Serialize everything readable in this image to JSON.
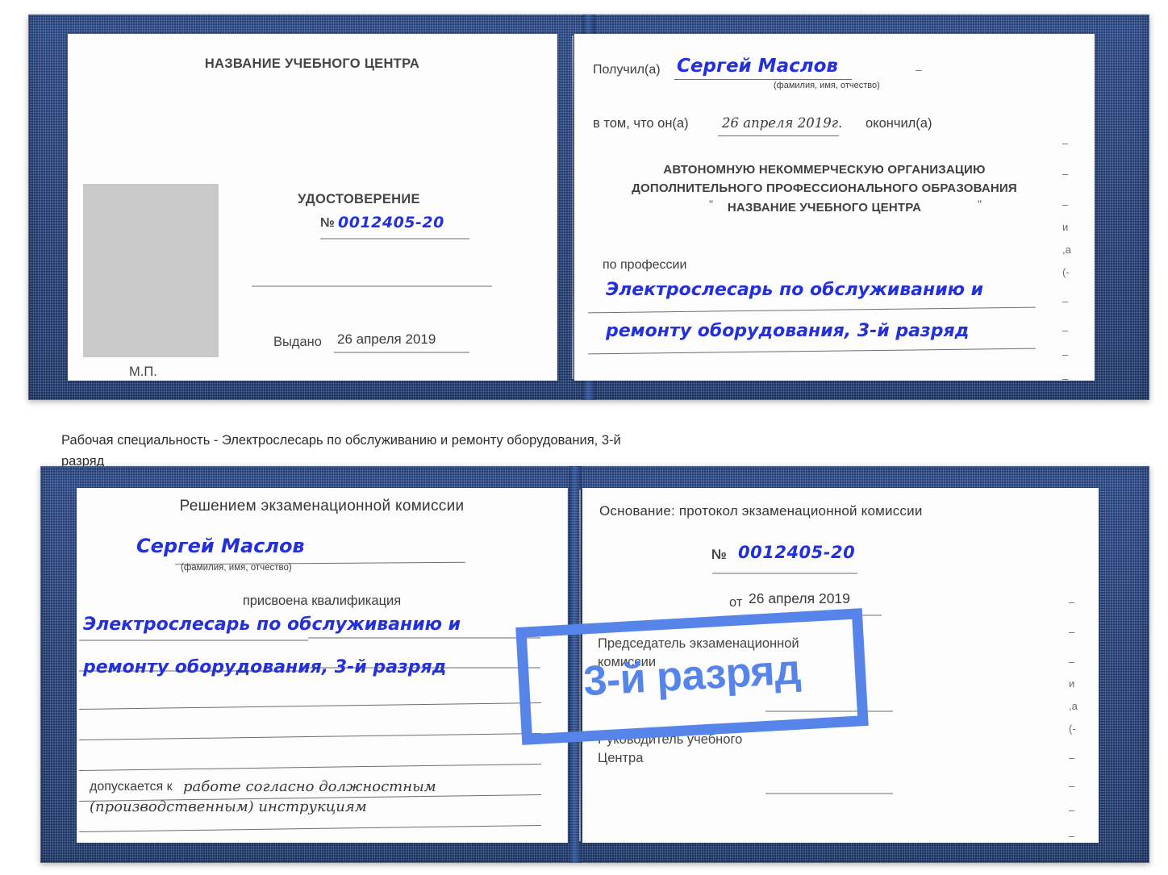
{
  "document": {
    "type": "certificate-scan",
    "colors": {
      "cover_blue": "#24417f",
      "handwriting_blue": "#2431d8",
      "watermark_blue": "#5684e8",
      "page_white": "#fdfdfd",
      "photo_placeholder_gray": "#c9c9c9",
      "rule_gray": "#9a9a9a"
    }
  },
  "caption": {
    "line1": "Рабочая специальность - Электрослесарь по обслуживанию и ремонту оборудования, 3-й",
    "line2": "разряд"
  },
  "watermark": {
    "text": "3-й разряд"
  },
  "certificate_top": {
    "left_page": {
      "org_title": "НАЗВАНИЕ УЧЕБНОГО ЦЕНТРА",
      "doc_title": "УДОСТОВЕРЕНИЕ",
      "number_label": "№",
      "number_value": "0012405-20",
      "issued_label": "Выдано",
      "issued_value": "26 апреля 2019",
      "seal_label": "М.П.",
      "photo_placeholder": "photo-placeholder"
    },
    "right_page": {
      "received_label": "Получил(а)",
      "received_value": "Сергей Маслов",
      "fio_hint": "(фамилия, имя, отчество)",
      "in_that_label": "в том, что он(а)",
      "in_that_value": "26 апреля 2019г.",
      "graduated_label": "окончил(а)",
      "org_line1": "АВТОНОМНУЮ НЕКОММЕРЧЕСКУЮ ОРГАНИЗАЦИЮ",
      "org_line2": "ДОПОЛНИТЕЛЬНОГО ПРОФЕССИОНАЛЬНОГО ОБРАЗОВАНИЯ",
      "org_quote_open": "\"",
      "org_line3": "НАЗВАНИЕ УЧЕБНОГО ЦЕНТРА",
      "org_quote_close": "\"",
      "profession_label": "по профессии",
      "profession_line1": "Электрослесарь по обслуживанию и",
      "profession_line2": "ремонту оборудования, 3-й разряд",
      "edge_marks": [
        "–",
        "–",
        "–",
        "и",
        ",а",
        "(-",
        "–",
        "–",
        "–",
        "–"
      ]
    }
  },
  "certificate_bottom": {
    "left_page": {
      "decision_title": "Решением экзаменационной комиссии",
      "name_value": "Сергей Маслов",
      "fio_hint": "(фамилия, имя, отчество)",
      "qualification_label": "присвоена квалификация",
      "qualification_line1": "Электрослесарь по обслуживанию и",
      "qualification_line2": "ремонту оборудования, 3-й разряд",
      "admitted_label": "допускается к",
      "admitted_value_line1": "работе согласно должностным",
      "admitted_value_line2": "(производственным) инструкциям"
    },
    "right_page": {
      "basis_label": "Основание: протокол экзаменационной комиссии",
      "number_label": "№",
      "number_value": "0012405-20",
      "from_label": "от",
      "from_value": "26 апреля 2019",
      "chairman_line1": "Председатель экзаменационной",
      "chairman_line2": "комиссии",
      "head_line1": "Руководитель учебного",
      "head_line2": "Центра",
      "edge_marks": [
        "–",
        "–",
        "–",
        "и",
        ",а",
        "(-",
        "–",
        "–",
        "–",
        "–"
      ]
    }
  }
}
